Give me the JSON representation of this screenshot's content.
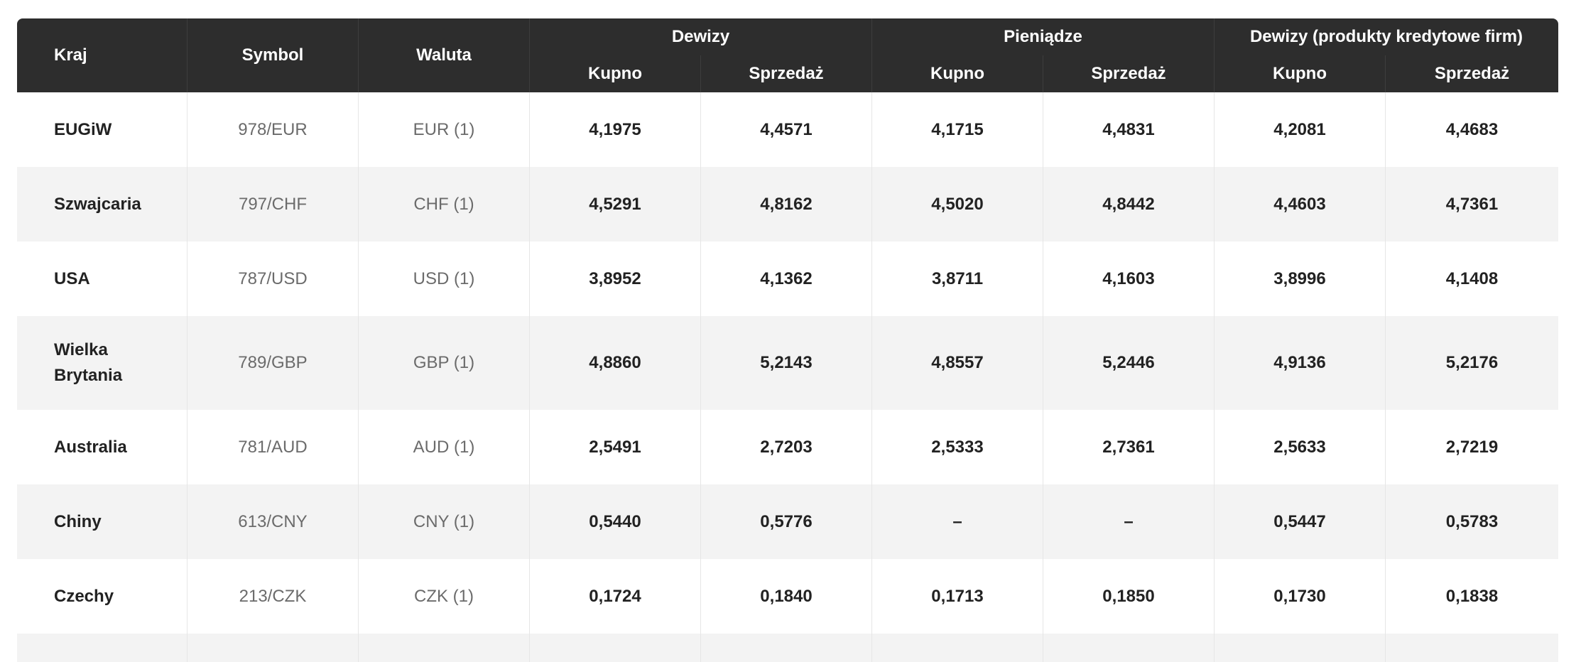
{
  "table": {
    "headers": {
      "country": "Kraj",
      "symbol": "Symbol",
      "currency": "Waluta",
      "groups": [
        "Dewizy",
        "Pieniądze",
        "Dewizy (produkty kredytowe firm)"
      ],
      "buy": "Kupno",
      "sell": "Sprzedaż"
    },
    "rows": [
      {
        "country": "EUGiW",
        "symbol": "978/EUR",
        "currency": "EUR (1)",
        "values": [
          "4,1975",
          "4,4571",
          "4,1715",
          "4,4831",
          "4,2081",
          "4,4683"
        ]
      },
      {
        "country": "Szwajcaria",
        "symbol": "797/CHF",
        "currency": "CHF (1)",
        "values": [
          "4,5291",
          "4,8162",
          "4,5020",
          "4,8442",
          "4,4603",
          "4,7361"
        ]
      },
      {
        "country": "USA",
        "symbol": "787/USD",
        "currency": "USD (1)",
        "values": [
          "3,8952",
          "4,1362",
          "3,8711",
          "4,1603",
          "3,8996",
          "4,1408"
        ]
      },
      {
        "country": "Wielka Brytania",
        "symbol": "789/GBP",
        "currency": "GBP (1)",
        "values": [
          "4,8860",
          "5,2143",
          "4,8557",
          "5,2446",
          "4,9136",
          "5,2176"
        ]
      },
      {
        "country": "Australia",
        "symbol": "781/AUD",
        "currency": "AUD (1)",
        "values": [
          "2,5491",
          "2,7203",
          "2,5333",
          "2,7361",
          "2,5633",
          "2,7219"
        ]
      },
      {
        "country": "Chiny",
        "symbol": "613/CNY",
        "currency": "CNY (1)",
        "values": [
          "0,5440",
          "0,5776",
          "–",
          "–",
          "0,5447",
          "0,5783"
        ]
      },
      {
        "country": "Czechy",
        "symbol": "213/CZK",
        "currency": "CZK (1)",
        "values": [
          "0,1724",
          "0,1840",
          "0,1713",
          "0,1850",
          "0,1730",
          "0,1838"
        ]
      }
    ]
  }
}
